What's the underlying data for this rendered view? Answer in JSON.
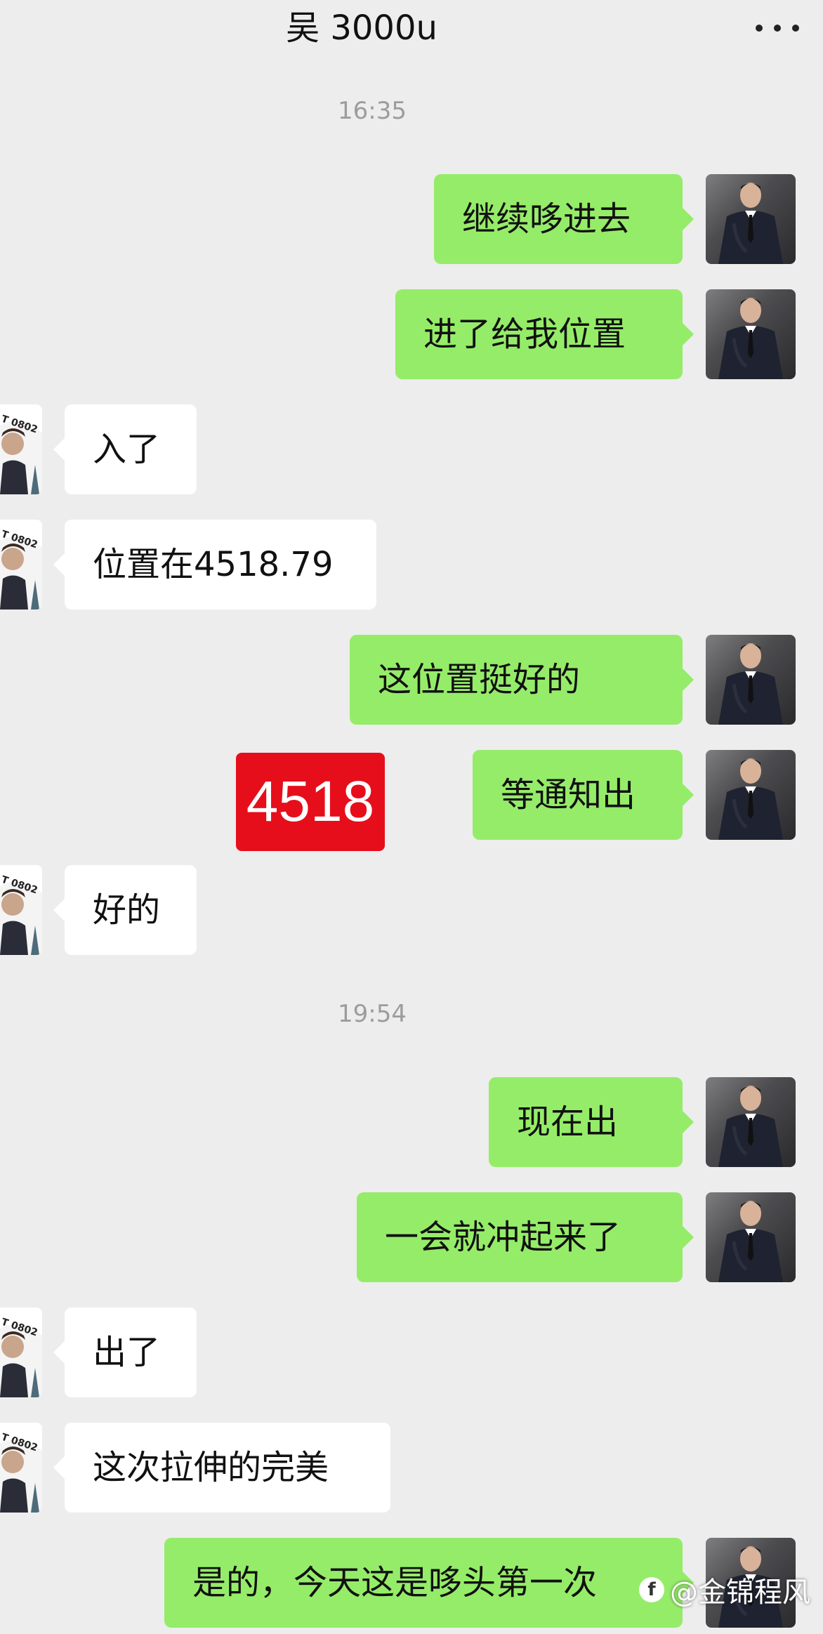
{
  "header": {
    "title": "吴 3000u",
    "more_icon": "more-horizontal-icon"
  },
  "timestamps": [
    "16:35",
    "19:54"
  ],
  "messages": [
    {
      "side": "out",
      "text": "继续哆进去"
    },
    {
      "side": "out",
      "text": "进了给我位置"
    },
    {
      "side": "in",
      "text": "入了"
    },
    {
      "side": "in",
      "text": "位置在4518.79"
    },
    {
      "side": "out",
      "text": "这位置挺好的"
    },
    {
      "side": "out",
      "text": "等通知出"
    },
    {
      "side": "in",
      "text": "好的"
    },
    {
      "side": "out",
      "text": "现在出"
    },
    {
      "side": "out",
      "text": "一会就冲起来了"
    },
    {
      "side": "in",
      "text": "出了"
    },
    {
      "side": "in",
      "text": "这次拉伸的完美"
    },
    {
      "side": "out",
      "text": "是的，今天这是哆头第一次"
    }
  ],
  "overlay": {
    "price_tag": "4518",
    "price_tag_color": "#e60e1b"
  },
  "avatar_them": {
    "badge_text": "T 0802"
  },
  "watermark": {
    "text": "@金锦程风",
    "icon": "social-logo-icon"
  },
  "colors": {
    "outgoing_bubble": "#95ec69",
    "incoming_bubble": "#ffffff",
    "background": "#ededed"
  }
}
